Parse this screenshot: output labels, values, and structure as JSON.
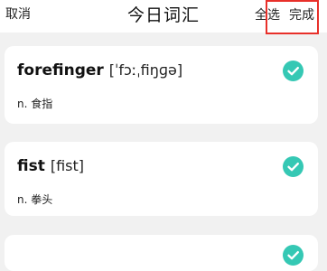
{
  "header": {
    "cancel_label": "取消",
    "title": "今日词汇",
    "select_all_label": "全选",
    "done_label": "完成"
  },
  "accent_color": "#35c8b4",
  "highlight_color": "#e8302a",
  "words": [
    {
      "word": "forefinger",
      "phonetic": "[ˈfɔːˌfiŋɡə]",
      "meaning": "n. 食指",
      "checked": true
    },
    {
      "word": "fist",
      "phonetic": "[fist]",
      "meaning": "n. 拳头",
      "checked": true
    },
    {
      "checked": true
    }
  ]
}
